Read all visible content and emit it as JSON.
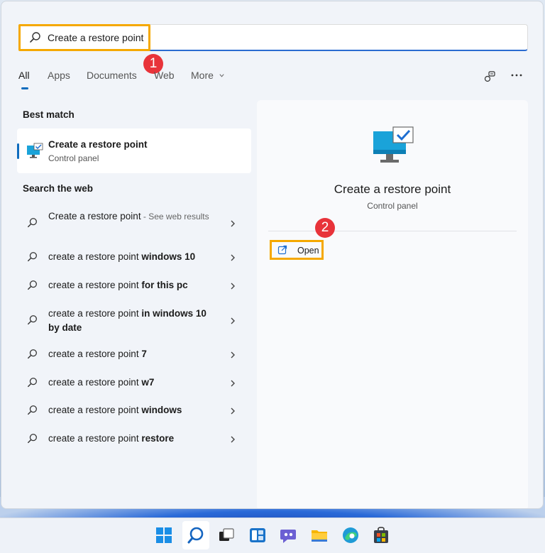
{
  "search": {
    "value": "Create a restore point"
  },
  "badges": {
    "first": "1",
    "second": "2"
  },
  "tabs": [
    {
      "label": "All"
    },
    {
      "label": "Apps"
    },
    {
      "label": "Documents"
    },
    {
      "label": "Web"
    },
    {
      "label": "More"
    }
  ],
  "best_match": {
    "heading": "Best match",
    "title": "Create a restore point",
    "subtitle": "Control panel"
  },
  "search_web": {
    "heading": "Search the web",
    "items": [
      {
        "normal": "Create a restore point",
        "bold": "",
        "suffix": " - See web results"
      },
      {
        "normal": "create a restore point ",
        "bold": "windows 10",
        "suffix": ""
      },
      {
        "normal": "create a restore point ",
        "bold": "for this pc",
        "suffix": ""
      },
      {
        "normal": "create a restore point ",
        "bold": "in windows 10 by date",
        "suffix": ""
      },
      {
        "normal": "create a restore point ",
        "bold": "7",
        "suffix": ""
      },
      {
        "normal": "create a restore point ",
        "bold": "w7",
        "suffix": ""
      },
      {
        "normal": "create a restore point ",
        "bold": "windows",
        "suffix": ""
      },
      {
        "normal": "create a restore point ",
        "bold": "restore",
        "suffix": ""
      }
    ]
  },
  "preview": {
    "title": "Create a restore point",
    "subtitle": "Control panel",
    "open_label": "Open"
  },
  "colors": {
    "accent": "#0f6cbd",
    "highlight": "#f5a800",
    "badge": "#e8333a"
  }
}
